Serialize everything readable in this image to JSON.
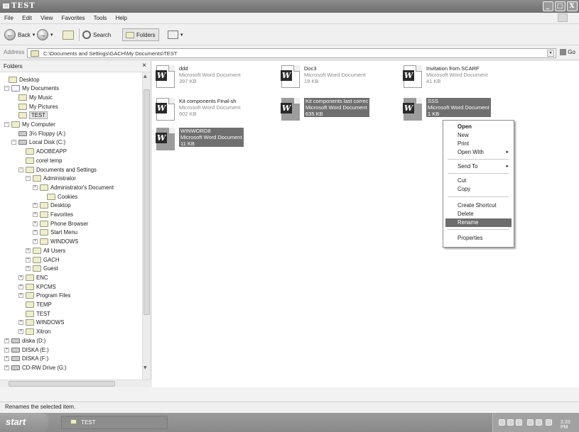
{
  "window": {
    "title": "TEST",
    "buttons": [
      "_",
      "□",
      "X"
    ]
  },
  "menu": [
    "File",
    "Edit",
    "View",
    "Favorites",
    "Tools",
    "Help"
  ],
  "toolbar": {
    "back_label": "Back",
    "search_label": "Search",
    "folders_label": "Folders"
  },
  "address": {
    "label": "Address",
    "value": "C:\\Documents and Settings\\GACH\\My Documents\\TEST",
    "go_label": "Go"
  },
  "left_pane": {
    "title": "Folders",
    "close": "×"
  },
  "tree": [
    {
      "label": "Desktop",
      "expander": ""
    },
    {
      "label": "My Documents",
      "expander": "−"
    },
    {
      "label": "My Music",
      "expander": ""
    },
    {
      "label": "My Pictures",
      "expander": ""
    },
    {
      "label": "TEST",
      "expander": ""
    },
    {
      "label": "My Computer",
      "expander": "−"
    },
    {
      "label": "3½ Floppy (A:)",
      "expander": ""
    },
    {
      "label": "Local Disk (C:)",
      "expander": "−"
    },
    {
      "label": "ADOBEAPP",
      "expander": ""
    },
    {
      "label": "corel temp",
      "expander": ""
    },
    {
      "label": "Documents and Settings",
      "expander": "−"
    },
    {
      "label": "Administrator",
      "expander": "−"
    },
    {
      "label": "Administrator's Document",
      "expander": "+"
    },
    {
      "label": "Cookies",
      "expander": ""
    },
    {
      "label": "Desktop",
      "expander": "+"
    },
    {
      "label": "Favorites",
      "expander": "+"
    },
    {
      "label": "Phone Browser",
      "expander": "+"
    },
    {
      "label": "Start Menu",
      "expander": "+"
    },
    {
      "label": "WINDOWS",
      "expander": "+"
    },
    {
      "label": "All Users",
      "expander": "+"
    },
    {
      "label": "GACH",
      "expander": "+"
    },
    {
      "label": "Guest",
      "expander": "+"
    },
    {
      "label": "ENC",
      "expander": "+"
    },
    {
      "label": "KPCMS",
      "expander": "+"
    },
    {
      "label": "Program Files",
      "expander": "+"
    },
    {
      "label": "TEMP",
      "expander": ""
    },
    {
      "label": "TEST",
      "expander": ""
    },
    {
      "label": "WINDOWS",
      "expander": "+"
    },
    {
      "label": "Xitron",
      "expander": "+"
    },
    {
      "label": "diska (D:)",
      "expander": "+"
    },
    {
      "label": "DISKA (E:)",
      "expander": "+"
    },
    {
      "label": "DISKA (F:)",
      "expander": "+"
    },
    {
      "label": "CD-RW Drive (G:)",
      "expander": "+"
    }
  ],
  "files": [
    {
      "name": "ddd",
      "type": "Microsoft Word Document",
      "size": "397 KB",
      "selected": false
    },
    {
      "name": "Doc3",
      "type": "Microsoft Word Document",
      "size": "19 KB",
      "selected": false
    },
    {
      "name": "Invitation from SCARF",
      "type": "Microsoft Word Document",
      "size": "41 KB",
      "selected": false
    },
    {
      "name": "Kit components Final-sh",
      "type": "Microsoft Word Document",
      "size": "602 KB",
      "selected": false
    },
    {
      "name": "Kit components last correc",
      "type": "Microsoft Word Document",
      "size": "635 KB",
      "selected": true
    },
    {
      "name": "SSS",
      "type": "Microsoft Word Document",
      "size": "1 KB",
      "selected": true
    },
    {
      "name": "WINWORD8",
      "type": "Microsoft Word Document",
      "size": "11 KB",
      "selected": true
    }
  ],
  "context_menu": [
    {
      "label": "Open",
      "arrow": ""
    },
    {
      "label": "New",
      "arrow": ""
    },
    {
      "label": "Print",
      "arrow": ""
    },
    {
      "label": "Open With",
      "arrow": "▸"
    },
    {
      "label": "Send To",
      "arrow": "▸"
    },
    {
      "label": "Cut",
      "arrow": ""
    },
    {
      "label": "Copy",
      "arrow": ""
    },
    {
      "label": "Create Shortcut",
      "arrow": ""
    },
    {
      "label": "Delete",
      "arrow": ""
    },
    {
      "label": "Rename",
      "arrow": ""
    },
    {
      "label": "Properties",
      "arrow": ""
    }
  ],
  "status": "Renames the selected item.",
  "taskbar": {
    "start": "start",
    "task": "TEST",
    "clock": "2:20 PM"
  }
}
